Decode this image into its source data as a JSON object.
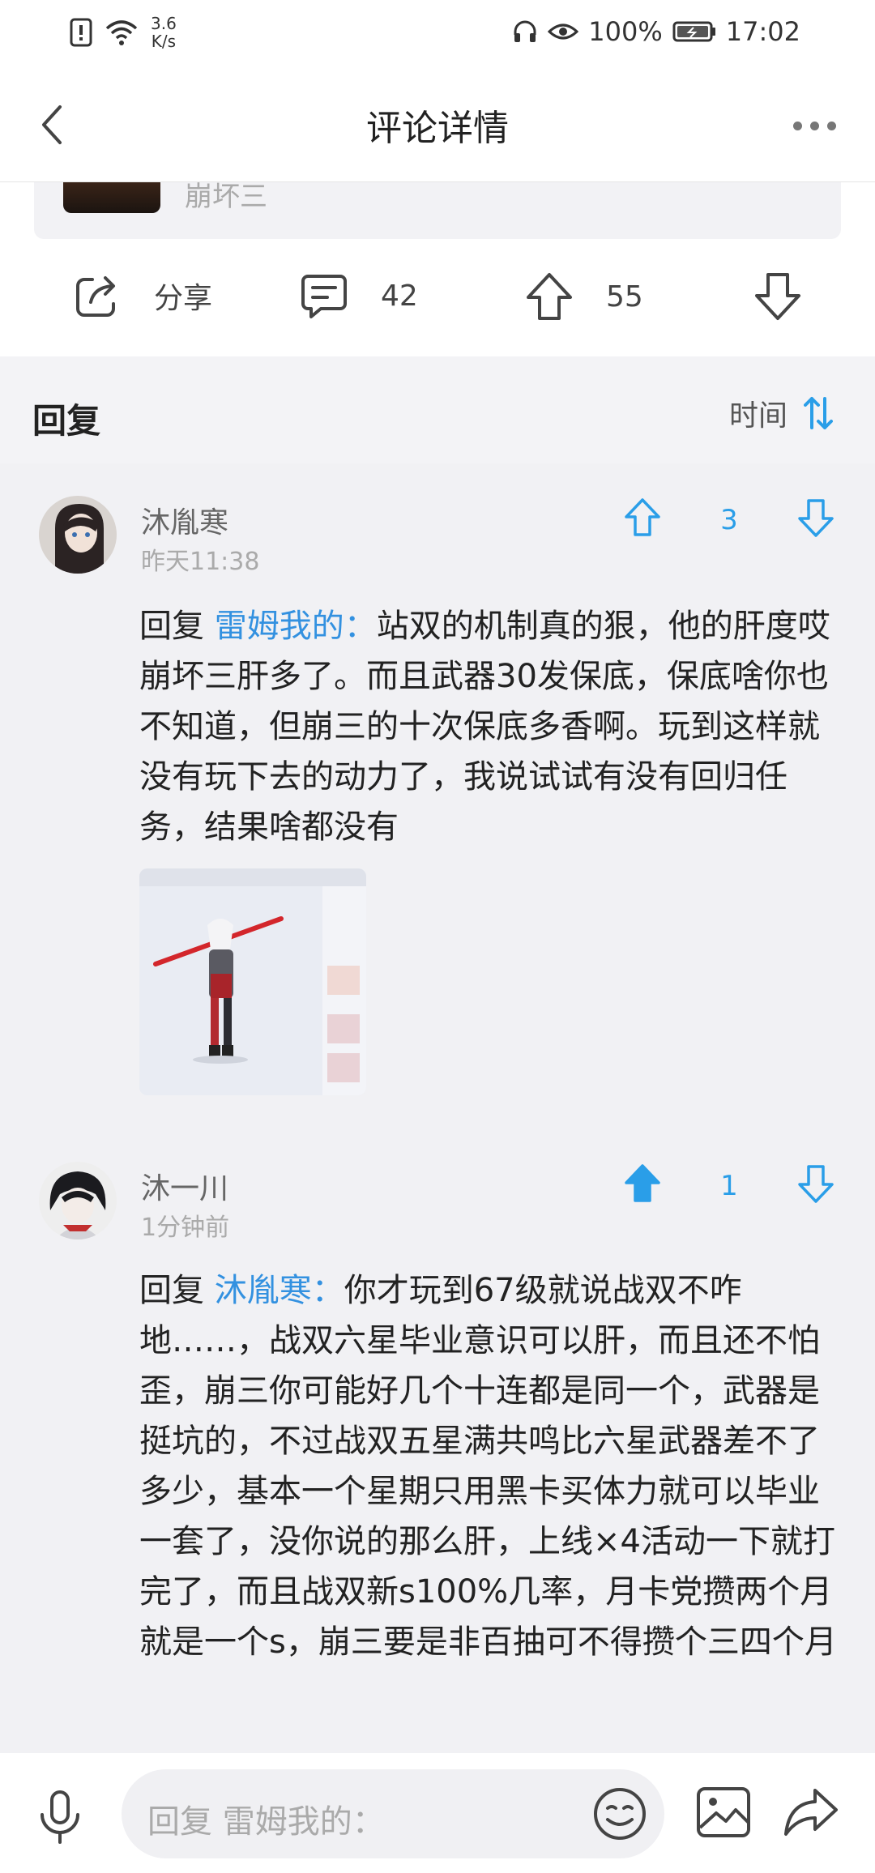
{
  "status_bar": {
    "net_speed_value": "3.6",
    "net_speed_unit": "K/s",
    "battery": "100%",
    "time": "17:02"
  },
  "header": {
    "title": "评论详情"
  },
  "post": {
    "game_name": "崩坏三",
    "share_label": "分享",
    "comment_count": "42",
    "upvote_count": "55"
  },
  "replies": {
    "title": "回复",
    "sort_label": "时间"
  },
  "comments": [
    {
      "username": "沐胤寒",
      "time": "昨天11:38",
      "votes": "3",
      "reply_prefix": "回复 ",
      "mention": "雷姆我的：",
      "text": "站双的机制真的狠，他的肝度哎崩坏三肝多了。而且武器30发保底，保底啥你也不知道，但崩三的十次保底多香啊。玩到这样就没有玩下去的动力了，我说试试有没有回归任务，结果啥都没有"
    },
    {
      "username": "沐一川",
      "time": "1分钟前",
      "votes": "1",
      "reply_prefix": "回复 ",
      "mention": "沐胤寒：",
      "text": "你才玩到67级就说战双不咋地……，战双六星毕业意识可以肝，而且还不怕歪，崩三你可能好几个十连都是同一个，武器是挺坑的，不过战双五星满共鸣比六星武器差不了多少，基本一个星期只用黑卡买体力就可以毕业一套了，没你说的那么肝，上线×4活动一下就打完了，而且战双新s100%几率，月卡党攒两个月就是一个s，崩三要是非百抽可不得攒个三四个月"
    }
  ],
  "bottom_bar": {
    "input_placeholder": "回复 雷姆我的："
  },
  "colors": {
    "accent": "#2a9ee8",
    "mention": "#3391e0"
  }
}
